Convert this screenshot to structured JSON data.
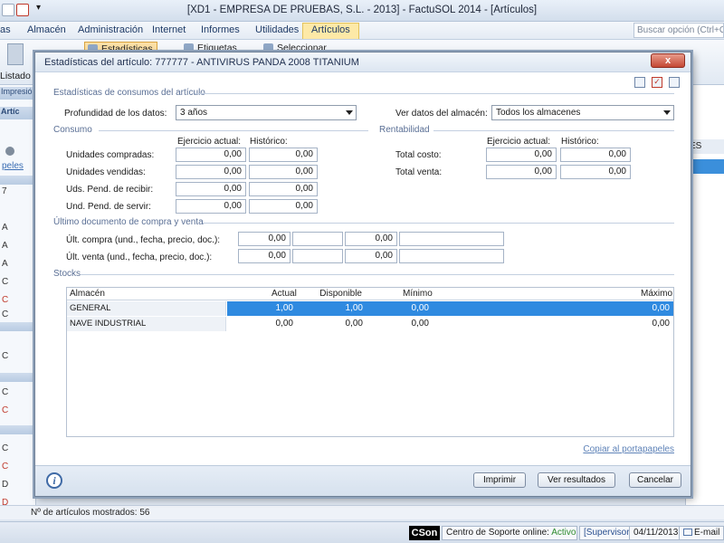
{
  "app": {
    "window_title": "[XD1 - EMPRESA DE PRUEBAS, S.L. - 2013] - FactuSOL 2014 - [Artículos]",
    "menu": [
      "as",
      "Almacén",
      "Administración",
      "Internet",
      "Informes",
      "Utilidades",
      "Artículos"
    ],
    "active_menu": "Artículos",
    "search_placeholder": "Buscar opción (Ctrl+O)",
    "ribbon": {
      "estadisticas": "Estadísticas",
      "etiquetas": "Etiquetas",
      "seleccionar": "Seleccionar",
      "listado": "Listado",
      "impresion": "Impresión"
    },
    "side": {
      "header": "Artíc",
      "link": "peles",
      "rows": [
        "C",
        "7",
        "A",
        "A",
        "A",
        "C",
        "C",
        "C",
        "C",
        "C",
        "C",
        "C",
        "C",
        "D",
        "D",
        "D"
      ]
    },
    "right_col": {
      "header": "ES"
    },
    "bottom_count": "Nº de artículos mostrados: 56",
    "status": {
      "brand": "CSon",
      "support_label": "Centro de Soporte online:",
      "support_state": "Activo",
      "user": "[Supervisor]",
      "date": "04/11/2013",
      "email": "E-mail"
    }
  },
  "dialog": {
    "title": "Estadísticas del artículo: 777777 - ANTIVIRUS PANDA 2008 TITANIUM",
    "close": "x",
    "section_main": "Estadísticas de consumos del artículo",
    "depth_label": "Profundidad de los datos:",
    "depth_value": "3 años",
    "store_label": "Ver datos del almacén:",
    "store_value": "Todos los almacenes",
    "consumo": {
      "title": "Consumo",
      "col_current": "Ejercicio actual:",
      "col_hist": "Histórico:",
      "rows": [
        {
          "label": "Unidades compradas:",
          "current": "0,00",
          "hist": "0,00"
        },
        {
          "label": "Unidades vendidas:",
          "current": "0,00",
          "hist": "0,00"
        },
        {
          "label": "Uds. Pend. de recibir:",
          "current": "0,00",
          "hist": "0,00"
        },
        {
          "label": "Und. Pend. de servir:",
          "current": "0,00",
          "hist": "0,00"
        }
      ]
    },
    "rentabilidad": {
      "title": "Rentabilidad",
      "col_current": "Ejercicio actual:",
      "col_hist": "Histórico:",
      "rows": [
        {
          "label": "Total costo:",
          "current": "0,00",
          "hist": "0,00"
        },
        {
          "label": "Total venta:",
          "current": "0,00",
          "hist": "0,00"
        }
      ]
    },
    "ultimo": {
      "title": "Último documento de compra y venta",
      "rows": [
        {
          "label": "Últ. compra (und., fecha, precio, doc.):",
          "und": "0,00",
          "fecha": "",
          "precio": "0,00",
          "doc": ""
        },
        {
          "label": "Últ. venta (und., fecha, precio, doc.):",
          "und": "0,00",
          "fecha": "",
          "precio": "0,00",
          "doc": ""
        }
      ]
    },
    "stocks": {
      "title": "Stocks",
      "headers": {
        "almacen": "Almacén",
        "actual": "Actual",
        "disponible": "Disponible",
        "minimo": "Mínimo",
        "maximo": "Máximo"
      },
      "rows": [
        {
          "almacen": "GENERAL",
          "actual": "1,00",
          "disponible": "1,00",
          "minimo": "0,00",
          "maximo": "0,00"
        },
        {
          "almacen": "NAVE INDUSTRIAL",
          "actual": "0,00",
          "disponible": "0,00",
          "minimo": "0,00",
          "maximo": "0,00"
        }
      ]
    },
    "copy_link": "Copiar al portapapeles",
    "buttons": {
      "print": "Imprimir",
      "results": "Ver resultados",
      "cancel": "Cancelar"
    }
  }
}
